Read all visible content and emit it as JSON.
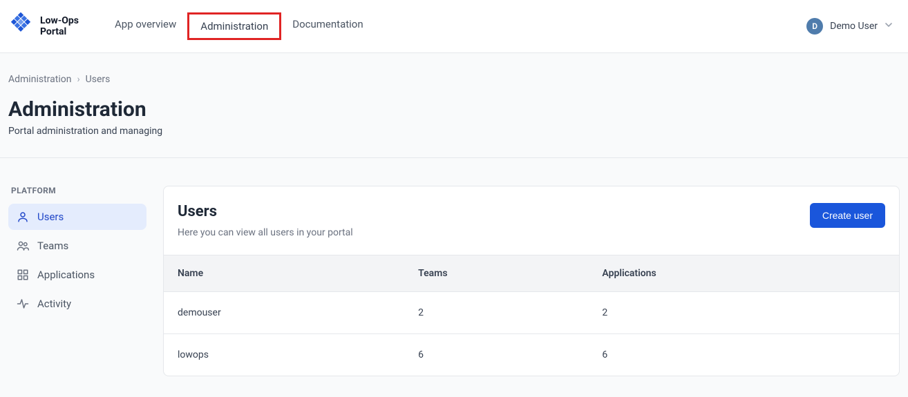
{
  "brand": {
    "line1": "Low-Ops",
    "line2": "Portal"
  },
  "nav": {
    "app_overview": "App overview",
    "administration": "Administration",
    "documentation": "Documentation"
  },
  "user": {
    "initial": "D",
    "name": "Demo User"
  },
  "breadcrumb": {
    "root": "Administration",
    "current": "Users"
  },
  "page": {
    "title": "Administration",
    "subtitle": "Portal administration and managing"
  },
  "sidebar": {
    "heading": "PLATFORM",
    "items": [
      {
        "label": "Users"
      },
      {
        "label": "Teams"
      },
      {
        "label": "Applications"
      },
      {
        "label": "Activity"
      }
    ]
  },
  "panel": {
    "title": "Users",
    "description": "Here you can view all users in your portal",
    "create_button": "Create user"
  },
  "table": {
    "columns": {
      "name": "Name",
      "teams": "Teams",
      "apps": "Applications"
    },
    "rows": [
      {
        "name": "demouser",
        "teams": "2",
        "apps": "2"
      },
      {
        "name": "lowops",
        "teams": "6",
        "apps": "6"
      }
    ]
  }
}
